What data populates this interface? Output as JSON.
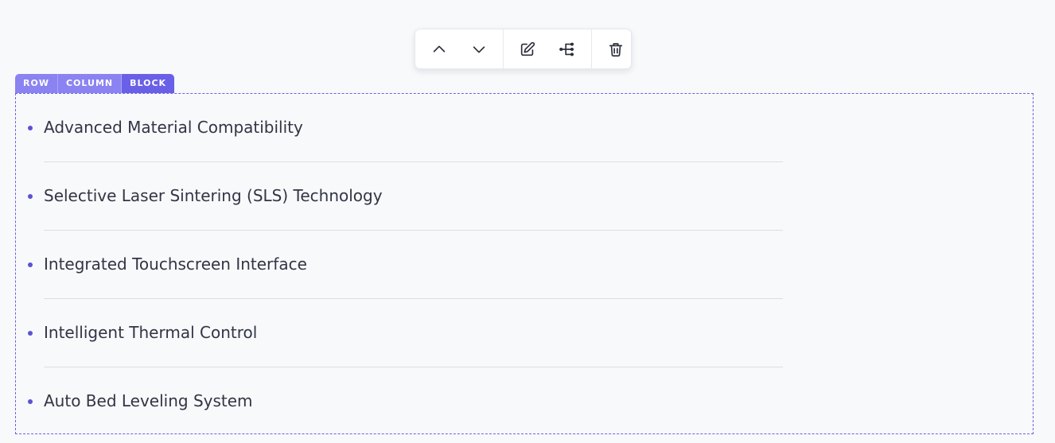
{
  "toolbar": {
    "buttons": [
      {
        "name": "move-up-button",
        "icon": "chevron-up-icon"
      },
      {
        "name": "move-down-button",
        "icon": "chevron-down-icon"
      },
      {
        "name": "edit-button",
        "icon": "edit-icon"
      },
      {
        "name": "navigator-button",
        "icon": "tree-icon"
      },
      {
        "name": "delete-button",
        "icon": "trash-icon"
      }
    ]
  },
  "breadcrumb": {
    "row": "ROW",
    "column": "COLUMN",
    "block": "BLOCK"
  },
  "list": {
    "items": [
      "Advanced Material Compatibility",
      "Selective Laser Sintering (SLS) Technology",
      "Integrated Touchscreen Interface",
      "Intelligent Thermal Control",
      "Auto Bed Leveling System"
    ]
  },
  "colors": {
    "accent": "#6a5fe7",
    "accent_light": "#8b83f1",
    "bullet": "#5b52d6",
    "text": "#313545",
    "background": "#f8f9fb"
  }
}
